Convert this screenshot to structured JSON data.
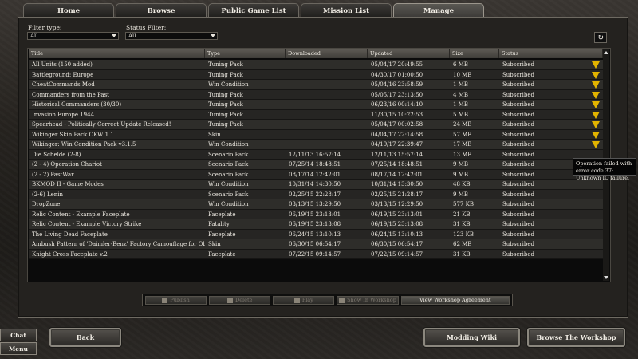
{
  "tabs": [
    "Home",
    "Browse",
    "Public Game List",
    "Mission List",
    "Manage"
  ],
  "active_tab": "Manage",
  "filters": {
    "type_label": "Filter type:",
    "type_value": "All",
    "status_label": "Status Filter:",
    "status_value": "All"
  },
  "table": {
    "headers": [
      "Title",
      "Type",
      "Downloaded",
      "Updated",
      "Size",
      "Status"
    ],
    "rows": [
      {
        "title": "All Units (150 added)",
        "type": "Tuning Pack",
        "downloaded": "",
        "updated": "05/04/17 20:49:55",
        "size": "6 MB",
        "status": "Subscribed",
        "warn": true
      },
      {
        "title": "Battleground: Europe",
        "type": "Tuning Pack",
        "downloaded": "",
        "updated": "04/30/17 01:00:50",
        "size": "10 MB",
        "status": "Subscribed",
        "warn": true
      },
      {
        "title": "CheatCommands Mod",
        "type": "Win Condition",
        "downloaded": "",
        "updated": "05/04/16 23:58:59",
        "size": "1 MB",
        "status": "Subscribed",
        "warn": true
      },
      {
        "title": "Commanders from the Past",
        "type": "Tuning Pack",
        "downloaded": "",
        "updated": "05/05/17 23:13:50",
        "size": "4 MB",
        "status": "Subscribed",
        "warn": true
      },
      {
        "title": "Historical Commanders (30/30)",
        "type": "Tuning Pack",
        "downloaded": "",
        "updated": "06/23/16 00:14:10",
        "size": "1 MB",
        "status": "Subscribed",
        "warn": true
      },
      {
        "title": "Invasion Europe 1944",
        "type": "Tuning Pack",
        "downloaded": "",
        "updated": "11/30/15 10:22:53",
        "size": "5 MB",
        "status": "Subscribed",
        "warn": true
      },
      {
        "title": "Spearhead - Politically Correct Update Released!",
        "type": "Tuning Pack",
        "downloaded": "",
        "updated": "05/04/17 00:02:58",
        "size": "24 MB",
        "status": "Subscribed",
        "warn": true
      },
      {
        "title": "Wikinger Skin Pack OKW 1.1",
        "type": "Skin",
        "downloaded": "",
        "updated": "04/04/17 22:14:58",
        "size": "57 MB",
        "status": "Subscribed",
        "warn": true
      },
      {
        "title": "Wikinger: Win Condition Pack v3.1.5",
        "type": "Win Condition",
        "downloaded": "",
        "updated": "04/19/17 22:39:47",
        "size": "17 MB",
        "status": "Subscribed",
        "warn": true
      },
      {
        "title": "Die Schelde (2-8)",
        "type": "Scenario Pack",
        "downloaded": "12/11/13 16:57:14",
        "updated": "12/11/13 15:57:14",
        "size": "13 MB",
        "status": "Subscribed",
        "warn": false
      },
      {
        "title": "(2 - 4) Operation Chariot",
        "type": "Scenario Pack",
        "downloaded": "07/25/14 18:48:51",
        "updated": "07/25/14 18:48:51",
        "size": "9 MB",
        "status": "Subscribed",
        "warn": false
      },
      {
        "title": "(2 - 2) FastWar",
        "type": "Scenario Pack",
        "downloaded": "08/17/14 12:42:01",
        "updated": "08/17/14 12:42:01",
        "size": "9 MB",
        "status": "Subscribed",
        "warn": false
      },
      {
        "title": "BKMOD II - Game Modes",
        "type": "Win Condition",
        "downloaded": "10/31/14 14:30:50",
        "updated": "10/31/14 13:30:50",
        "size": "48 KB",
        "status": "Subscribed",
        "warn": false
      },
      {
        "title": "(2-6) Lenin",
        "type": "Scenario Pack",
        "downloaded": "02/25/15 22:28:17",
        "updated": "02/25/15 21:28:17",
        "size": "9 MB",
        "status": "Subscribed",
        "warn": false
      },
      {
        "title": "DropZone",
        "type": "Win Condition",
        "downloaded": "03/13/15 13:29:50",
        "updated": "03/13/15 12:29:50",
        "size": "577 KB",
        "status": "Subscribed",
        "warn": false
      },
      {
        "title": "Relic Content - Example Faceplate",
        "type": "Faceplate",
        "downloaded": "06/19/15 23:13:01",
        "updated": "06/19/15 23:13:01",
        "size": "21 KB",
        "status": "Subscribed",
        "warn": false
      },
      {
        "title": "Relic Content - Example Victory Strike",
        "type": "Fatality",
        "downloaded": "06/19/15 23:13:08",
        "updated": "06/19/15 23:13:08",
        "size": "31 KB",
        "status": "Subscribed",
        "warn": false
      },
      {
        "title": "The Living Dead Faceplate",
        "type": "Faceplate",
        "downloaded": "06/24/15 13:10:13",
        "updated": "06/24/15 13:10:13",
        "size": "123 KB",
        "status": "Subscribed",
        "warn": false
      },
      {
        "title": "Ambush Pattern of 'Daimler-Benz' Factory Camouflage for Oberk",
        "type": "Skin",
        "downloaded": "06/30/15 06:54:17",
        "updated": "06/30/15 06:54:17",
        "size": "62 MB",
        "status": "Subscribed",
        "warn": false
      },
      {
        "title": "Knight Cross Faceplate v.2",
        "type": "Faceplate",
        "downloaded": "07/22/15 09:14:57",
        "updated": "07/22/15 09:14:57",
        "size": "31 KB",
        "status": "Subscribed",
        "warn": false
      }
    ]
  },
  "tooltip": {
    "line1": "Operation failed with error code 37:",
    "line2": "Unknown IO failure."
  },
  "actions": {
    "publish": "Publish",
    "delete": "Delete",
    "play": "Play",
    "show_in_workshop": "Show In Workshop",
    "view_agreement": "View Workshop Agreement"
  },
  "bottom": {
    "chat": "Chat",
    "menu": "Menu",
    "back": "Back",
    "modding_wiki": "Modding Wiki",
    "browse_workshop": "Browse The Workshop"
  },
  "colors": {
    "warning": "#e2b400",
    "panel": "#24221f",
    "table_bg": "#0b0b0b"
  }
}
